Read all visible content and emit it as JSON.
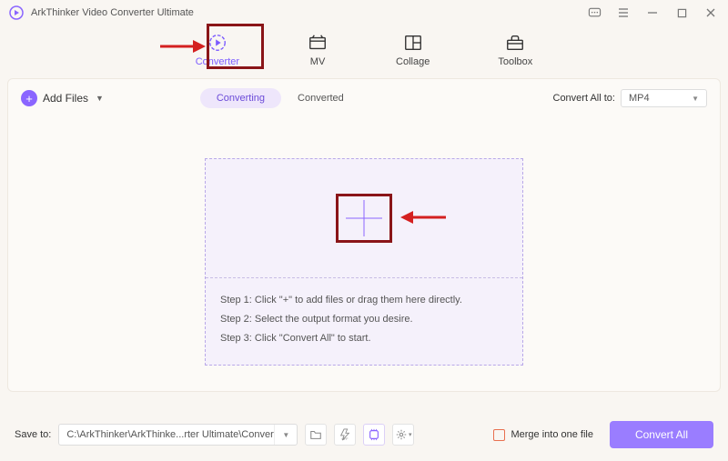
{
  "app": {
    "title": "ArkThinker Video Converter Ultimate"
  },
  "tabs": {
    "converter": "Converter",
    "mv": "MV",
    "collage": "Collage",
    "toolbox": "Toolbox"
  },
  "toolbar": {
    "add_files": "Add Files",
    "converting": "Converting",
    "converted": "Converted",
    "convert_all_to": "Convert All to:",
    "format": "MP4"
  },
  "steps": {
    "s1": "Step 1: Click \"+\" to add files or drag them here directly.",
    "s2": "Step 2: Select the output format you desire.",
    "s3": "Step 3: Click \"Convert All\" to start."
  },
  "footer": {
    "save_to": "Save to:",
    "path": "C:\\ArkThinker\\ArkThinke...rter Ultimate\\Converted",
    "merge": "Merge into one file",
    "convert_all": "Convert All"
  }
}
